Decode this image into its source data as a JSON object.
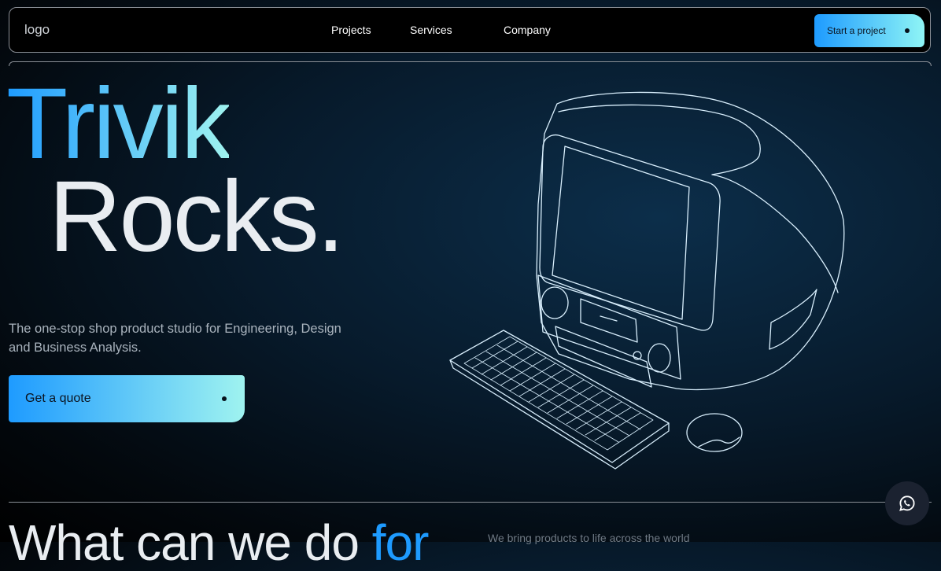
{
  "nav": {
    "logo": "logo",
    "links": [
      "Projects",
      "Services",
      "Company"
    ],
    "cta": "Start a project"
  },
  "hero": {
    "line1": "Trivik",
    "line2": "Rocks.",
    "subtitle": "The one-stop shop product studio for Engineering, Design and Business Analysis.",
    "cta": "Get a quote"
  },
  "section": {
    "heading_main": "What can we do ",
    "heading_accent": "for",
    "side_text": "We bring products to life across the world"
  },
  "icons": {
    "chat": "whatsapp-icon",
    "illustration": "retro-computer-illustration"
  },
  "colors": {
    "accent_start": "#1e9bff",
    "accent_end": "#9ff3f0",
    "background": "#071a2b"
  }
}
